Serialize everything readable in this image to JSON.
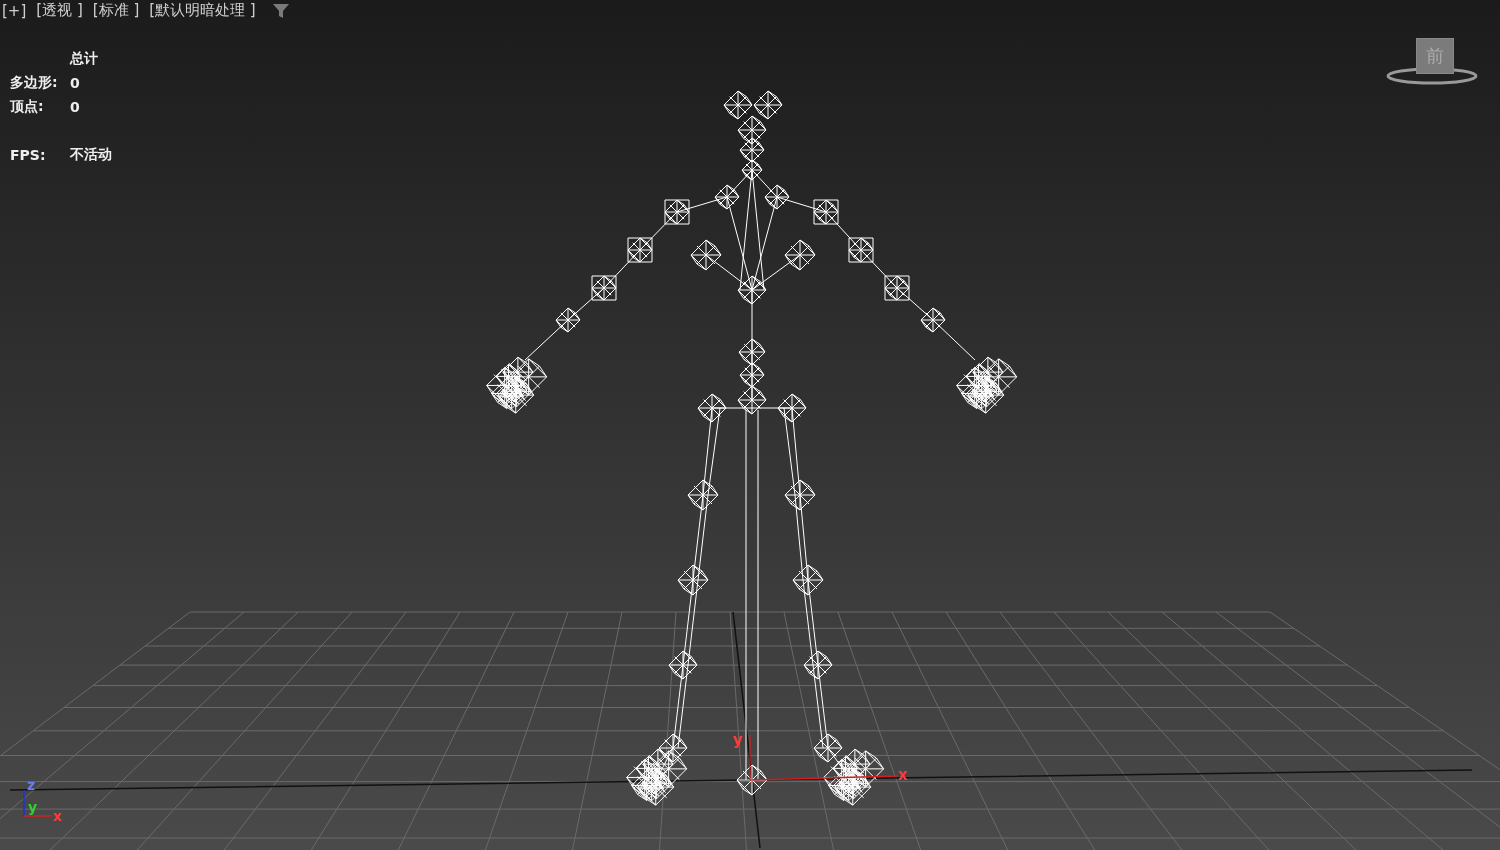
{
  "viewport": {
    "labels": [
      "[+]",
      "[透视 ]",
      "[标准 ]",
      "[默认明暗处理 ]"
    ],
    "stats": {
      "heading": "总计",
      "rows": [
        {
          "label": "多边形:",
          "value": "0"
        },
        {
          "label": "顶点:",
          "value": "0"
        }
      ],
      "fps": {
        "label": "FPS:",
        "value": "不活动"
      }
    },
    "view_cube": {
      "face": "前"
    },
    "gizmo_axes": {
      "x": "x",
      "y": "y"
    },
    "corner_axes": {
      "z": "z",
      "y": "y",
      "x": "x"
    }
  }
}
